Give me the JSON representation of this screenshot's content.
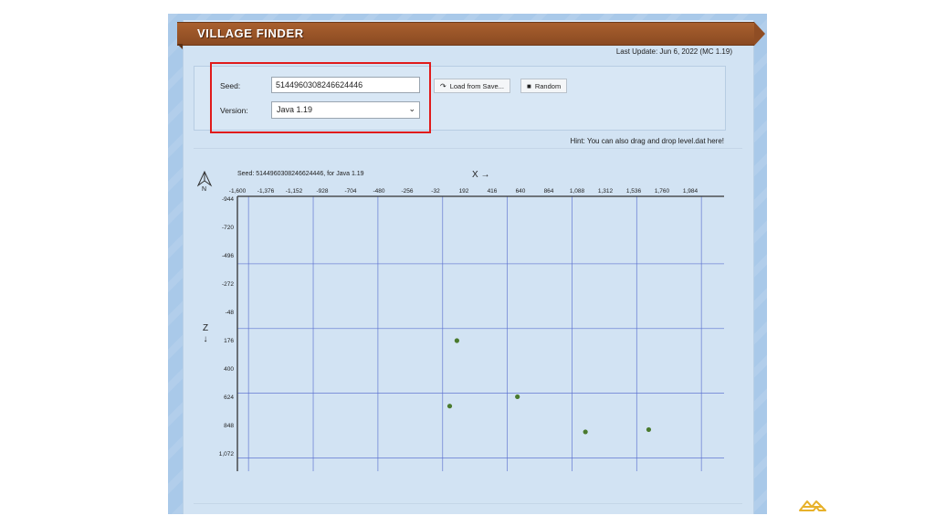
{
  "banner": {
    "title": "VILLAGE FINDER"
  },
  "last_update": "Last Update: Jun 6, 2022 (MC 1.19)",
  "form": {
    "seed_label": "Seed:",
    "seed_value": "5144960308246624446",
    "version_label": "Version:",
    "version_value": "Java 1.19",
    "load_button": "Load from Save...",
    "random_button": "Random"
  },
  "hint": "Hint: You can also drag and drop level.dat here!",
  "map": {
    "north_label": "N",
    "x_axis_label": "X →",
    "z_axis_label": "Z",
    "z_arrow": "↓"
  },
  "chart_data": {
    "type": "scatter",
    "title": "Seed: 5144960308246624446, for Java 1.19",
    "xlabel": "X →",
    "ylabel": "Z",
    "x_ticks": [
      "-1,600",
      "-1,376",
      "-1,152",
      "-928",
      "-704",
      "-480",
      "-256",
      "-32",
      "192",
      "416",
      "640",
      "864",
      "1,088",
      "1,312",
      "1,536",
      "1,760",
      "1,984"
    ],
    "y_ticks": [
      "-944",
      "-720",
      "-496",
      "-272",
      "-48",
      "176",
      "400",
      "624",
      "848",
      "1,072"
    ],
    "xlim": [
      -1600,
      2184
    ],
    "ylim": [
      -944,
      1230
    ],
    "grid": true,
    "points": [
      {
        "x": 137,
        "z": 176
      },
      {
        "x": 80,
        "z": 694
      },
      {
        "x": 616,
        "z": 620
      },
      {
        "x": 1154,
        "z": 898
      },
      {
        "x": 1655,
        "z": 880
      }
    ],
    "point_color": "#4a7a2e",
    "grid_color": "#5a6fd0"
  },
  "colors": {
    "banner": "#9c5529",
    "highlight": "#e01b1b",
    "panel": "#d2e3f3"
  }
}
